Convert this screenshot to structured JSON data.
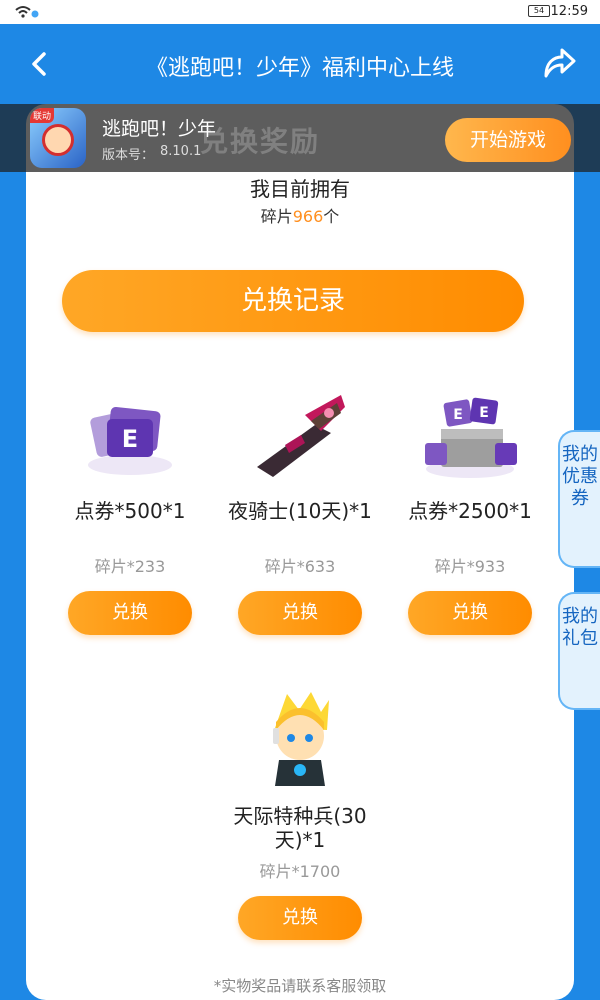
{
  "status_bar": {
    "time": "12:59",
    "battery": "54"
  },
  "title_bar": {
    "title": "《逃跑吧！少年》福利中心上线"
  },
  "banner": {
    "tag": "联动",
    "game_name": "逃跑吧！少年",
    "version_label": "版本号：",
    "version_value": "8.10.1",
    "ghost_title": "兑换奖励",
    "start_button": "开始游戏"
  },
  "owned": {
    "label": "我目前拥有",
    "prefix": "碎片",
    "count": "966",
    "suffix": "个"
  },
  "record_button": "兑换记录",
  "rewards": [
    {
      "name": "点券*500*1",
      "cost": "碎片*233",
      "button": "兑换"
    },
    {
      "name": "夜骑士(10天)*1",
      "cost": "碎片*633",
      "button": "兑换"
    },
    {
      "name": "点券*2500*1",
      "cost": "碎片*933",
      "button": "兑换"
    },
    {
      "name": "天际特种兵(30天)*1",
      "cost": "碎片*1700",
      "button": "兑换"
    }
  ],
  "side_tabs": {
    "coupons": "我的优惠券",
    "gifts": "我的礼包"
  },
  "footnote": "*实物奖品请联系客服领取",
  "colors": {
    "brand_blue": "#1e88e5",
    "accent_orange": "#ff8f1f"
  }
}
